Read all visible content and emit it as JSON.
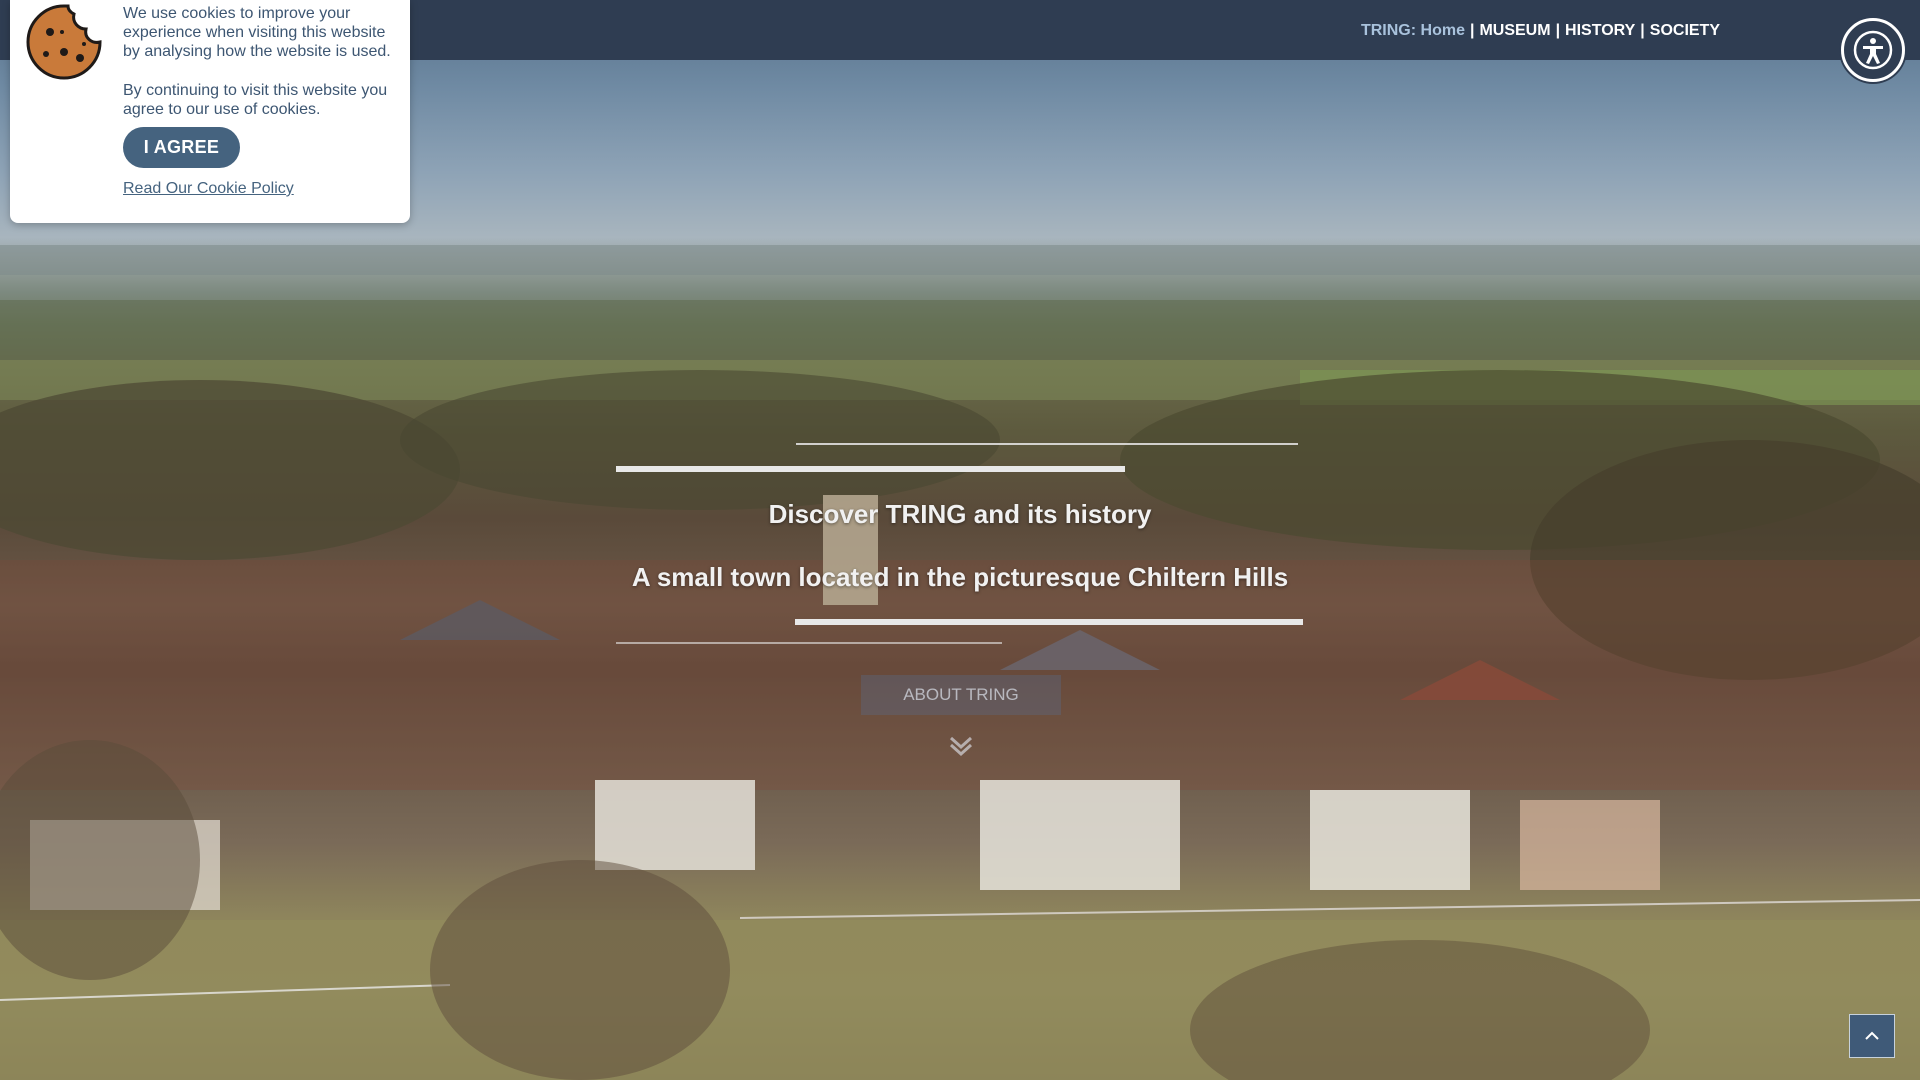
{
  "nav": {
    "brand_prefix": "TRING:",
    "home": "Home",
    "items": [
      "MUSEUM",
      "HISTORY",
      "SOCIETY"
    ],
    "separator": "|"
  },
  "cookie": {
    "paragraph1": "We use cookies to improve your experience when visiting this website by analysing how the website is used.",
    "paragraph2": "By continuing to visit this website you agree to our use of cookies.",
    "agree_label": "I AGREE",
    "policy_link": "Read Our Cookie Policy",
    "icon": "cookie-icon"
  },
  "hero": {
    "title": "Discover TRING and its history",
    "subtitle": "A small town located in the picturesque Chiltern Hills",
    "button_label": "ABOUT TRING"
  },
  "icons": {
    "accessibility": "accessibility-icon",
    "scroll_down": "chevron-down-icon",
    "back_to_top": "chevron-up-icon"
  },
  "colors": {
    "nav_bg": "#2f3d52",
    "brand": "#a9c2dc",
    "cookie_button": "#45637f"
  }
}
